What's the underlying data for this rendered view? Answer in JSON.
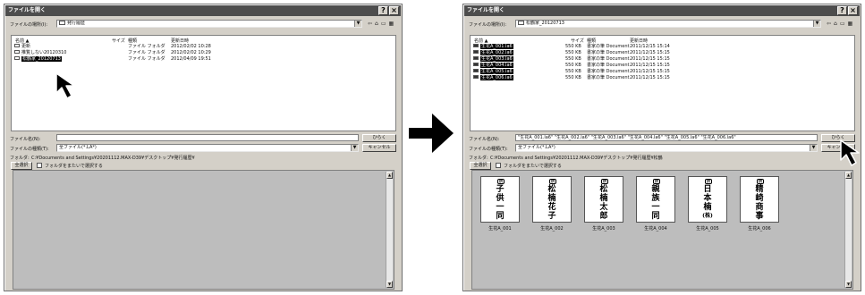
{
  "left_dialog": {
    "title": "ファイルを開く",
    "lookin_label": "ファイルの場所(I):",
    "lookin_value": "発行履歴",
    "columns": [
      "名前 ▲",
      "サイズ",
      "種類",
      "更新日時"
    ],
    "rows": [
      {
        "name": "更新",
        "size": "",
        "type": "ファイル フォルダ",
        "date": "2012/02/02 10:28"
      },
      {
        "name": "推覧しない20120310",
        "size": "",
        "type": "ファイル フォルダ",
        "date": "2012/02/02 10:29"
      },
      {
        "name": "松鶴家_20120713",
        "size": "",
        "type": "ファイル フォルダ",
        "date": "2012/04/09 19:51"
      }
    ],
    "filename_label": "ファイル名(N):",
    "filename_value": "",
    "filetype_label": "ファイルの種類(T):",
    "filetype_value": "全ファイル(*.LA*)",
    "folder_label": "フォルダ:",
    "folder_value": "C:¥Documents and Settings¥20201112.MAX-D39¥デスクトップ¥発行履歴¥",
    "open_button": "ひらく",
    "cancel_button": "キャンセル",
    "select_all_button": "全選択",
    "subfolder_checkbox": "フォルダをまたいで選択する"
  },
  "right_dialog": {
    "title": "ファイルを開く",
    "lookin_label": "ファイルの場所(I):",
    "lookin_value": "松鶴家_20120713",
    "columns": [
      "名前 ▲",
      "サイズ",
      "種類",
      "更新日時"
    ],
    "rows": [
      {
        "name": "生花A_001.la6",
        "size": "550 KB",
        "type": "書家の筆 Document",
        "date": "2011/12/15 15:14"
      },
      {
        "name": "生花A_002.la6",
        "size": "550 KB",
        "type": "書家の筆 Document",
        "date": "2011/12/15 15:15"
      },
      {
        "name": "生花A_003.la6",
        "size": "550 KB",
        "type": "書家の筆 Document",
        "date": "2011/12/15 15:15"
      },
      {
        "name": "生花A_004.la6",
        "size": "550 KB",
        "type": "書家の筆 Document",
        "date": "2011/12/15 15:15"
      },
      {
        "name": "生花A_005.la6",
        "size": "550 KB",
        "type": "書家の筆 Document",
        "date": "2011/12/15 15:15"
      },
      {
        "name": "生花A_006.la6",
        "size": "550 KB",
        "type": "書家の筆 Document",
        "date": "2011/12/15 15:15"
      }
    ],
    "filename_label": "ファイル名(N):",
    "filename_value": "\"生花A_001.la6\" \"生花A_002.la6\" \"生花A_003.la6\" \"生花A_004.la6\" \"生花A_005.la6\" \"生花A_006.la6\"",
    "filetype_label": "ファイルの種類(T):",
    "filetype_value": "全ファイル(*.LA*)",
    "folder_label": "フォルダ:",
    "folder_value": "C:¥Documents and Settings¥20201112.MAX-D39¥デスクトップ¥発行履歴¥松鶴",
    "open_button": "ひらく",
    "cancel_button": "キャンセル",
    "select_all_button": "全選択",
    "subfolder_checkbox": "フォルダをまたいで選択する",
    "thumbnails": [
      {
        "top": "供",
        "text": [
          "子",
          "供",
          "一",
          "同"
        ],
        "caption": "生花A_001"
      },
      {
        "top": "供",
        "text": [
          "松",
          "楠",
          "花",
          "子"
        ],
        "caption": "生花A_002"
      },
      {
        "top": "供",
        "text": [
          "松",
          "楠",
          "太",
          "郎"
        ],
        "caption": "生花A_003"
      },
      {
        "top": "供",
        "text": [
          "親",
          "族",
          "一",
          "同"
        ],
        "caption": "生花A_004"
      },
      {
        "top": "供",
        "text": [
          "日",
          "本",
          "楠",
          "(株)"
        ],
        "caption": "生花A_005"
      },
      {
        "top": "供",
        "text": [
          "精",
          "崎",
          "商",
          "事"
        ],
        "caption": "生花A_006"
      }
    ]
  }
}
